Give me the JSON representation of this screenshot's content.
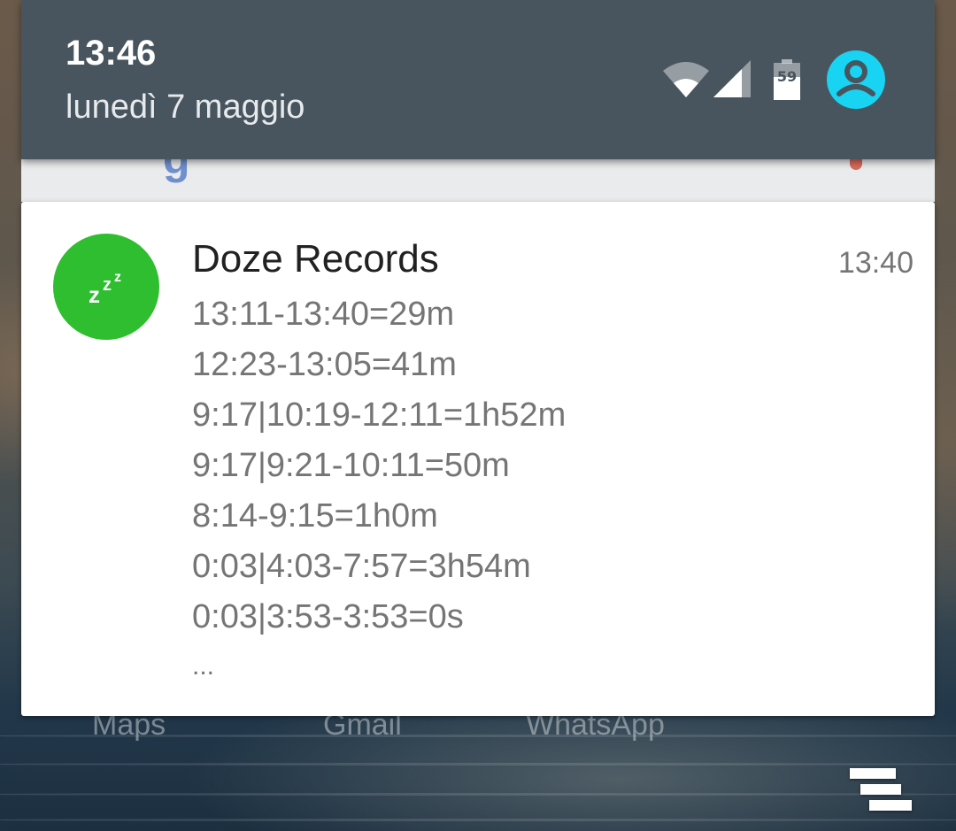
{
  "status_bar": {
    "time": "13:46",
    "date": "lunedì 7 maggio",
    "battery_level": "59",
    "icons": [
      "wifi-icon",
      "cell-signal-icon",
      "battery-icon",
      "account-icon"
    ],
    "account_color": "#18d4f2"
  },
  "background_apps": {
    "labels": [
      "Maps",
      "Gmail",
      "WhatsApp"
    ]
  },
  "notification": {
    "app_icon": "zzz-sleep-icon",
    "icon_color": "#2fbe2f",
    "title": "Doze Records",
    "time": "13:40",
    "lines": [
      "13:11-13:40=29m",
      "12:23-13:05=41m",
      "9:17|10:19-12:11=1h52m",
      "9:17|9:21-10:11=50m",
      "8:14-9:15=1h0m",
      "0:03|4:03-7:57=3h54m",
      "0:03|3:53-3:53=0s"
    ],
    "more": "..."
  },
  "actions": {
    "clear_all_icon": "clear-all-icon"
  }
}
